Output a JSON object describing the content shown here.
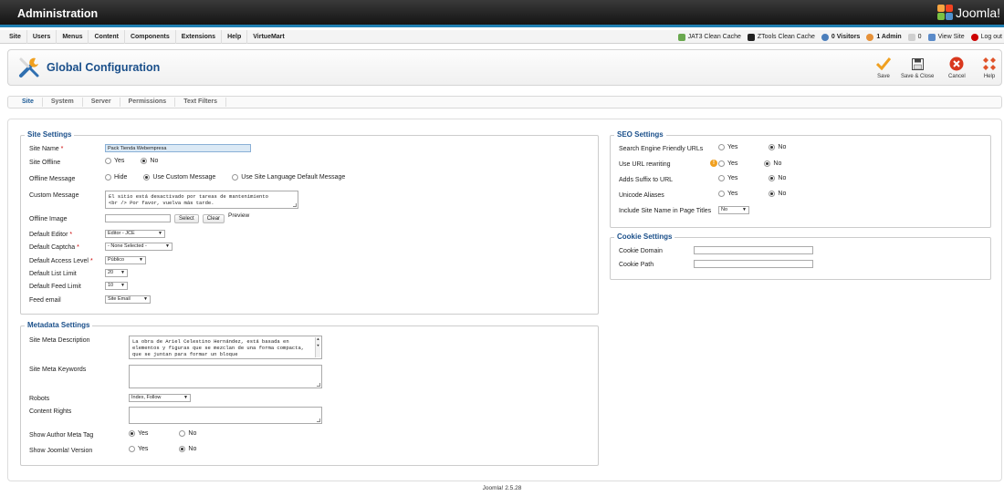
{
  "header": {
    "title": "Administration",
    "logo_text": "Joomla!"
  },
  "menu": {
    "items": [
      "Site",
      "Users",
      "Menus",
      "Content",
      "Components",
      "Extensions",
      "Help",
      "VirtueMart"
    ]
  },
  "status": {
    "jat3": "JAT3 Clean Cache",
    "ztools": "ZTools Clean Cache",
    "visitors": "0 Visitors",
    "admins": "1 Admin",
    "messages": "0",
    "view_site": "View Site",
    "logout": "Log out"
  },
  "toolbar": {
    "title": "Global Configuration",
    "save": "Save",
    "save_close": "Save & Close",
    "cancel": "Cancel",
    "help": "Help"
  },
  "tabs": [
    "Site",
    "System",
    "Server",
    "Permissions",
    "Text Filters"
  ],
  "site_settings": {
    "legend": "Site Settings",
    "site_name": {
      "label": "Site Name",
      "value": "Pack Tienda Webempresa"
    },
    "site_offline": {
      "label": "Site Offline",
      "yes": "Yes",
      "no": "No"
    },
    "offline_message": {
      "label": "Offline Message",
      "hide": "Hide",
      "custom": "Use Custom Message",
      "default": "Use Site Language Default Message"
    },
    "custom_message": {
      "label": "Custom Message",
      "value": "El sitio está desactivado por tareas de mantenimiento\n<br /> Por favor, vuelva más tarde."
    },
    "offline_image": {
      "label": "Offline Image",
      "select": "Select",
      "clear": "Clear",
      "preview": "Preview"
    },
    "default_editor": {
      "label": "Default Editor",
      "value": "Editor - JCE"
    },
    "default_captcha": {
      "label": "Default Captcha",
      "value": "- None Selected -"
    },
    "default_access": {
      "label": "Default Access Level",
      "value": "Público"
    },
    "list_limit": {
      "label": "Default List Limit",
      "value": "20"
    },
    "feed_limit": {
      "label": "Default Feed Limit",
      "value": "10"
    },
    "feed_email": {
      "label": "Feed email",
      "value": "Site Email"
    },
    "required_mark": "*"
  },
  "metadata_settings": {
    "legend": "Metadata Settings",
    "description": {
      "label": "Site Meta Description",
      "value": "La obra de Ariel Celestino Hernández, está basada en elementos y figuras que se mezclan de una forma compacta, que se juntan para formar un bloque"
    },
    "keywords": {
      "label": "Site Meta Keywords",
      "value": ""
    },
    "robots": {
      "label": "Robots",
      "value": "Index, Follow"
    },
    "content_rights": {
      "label": "Content Rights",
      "value": ""
    },
    "author_meta": {
      "label": "Show Author Meta Tag",
      "yes": "Yes",
      "no": "No"
    },
    "joomla_version": {
      "label": "Show Joomla! Version",
      "yes": "Yes",
      "no": "No"
    }
  },
  "seo_settings": {
    "legend": "SEO Settings",
    "sef_urls": {
      "label": "Search Engine Friendly URLs",
      "yes": "Yes",
      "no": "No"
    },
    "url_rewriting": {
      "label": "Use URL rewriting",
      "yes": "Yes",
      "no": "No"
    },
    "suffix": {
      "label": "Adds Suffix to URL",
      "yes": "Yes",
      "no": "No"
    },
    "unicode": {
      "label": "Unicode Aliases",
      "yes": "Yes",
      "no": "No"
    },
    "site_name_titles": {
      "label": "Include Site Name in Page Titles",
      "value": "No"
    }
  },
  "cookie_settings": {
    "legend": "Cookie Settings",
    "domain": {
      "label": "Cookie Domain",
      "value": ""
    },
    "path": {
      "label": "Cookie Path",
      "value": ""
    }
  },
  "footer": {
    "version": "Joomla! 2.5.28"
  },
  "colors": {
    "accent": "#1a4f8a",
    "topbar": "#1f1f1f",
    "stripe": "#1f80b3",
    "save": "#f0a020",
    "cancel": "#d9381e",
    "help": "#e0532a"
  }
}
